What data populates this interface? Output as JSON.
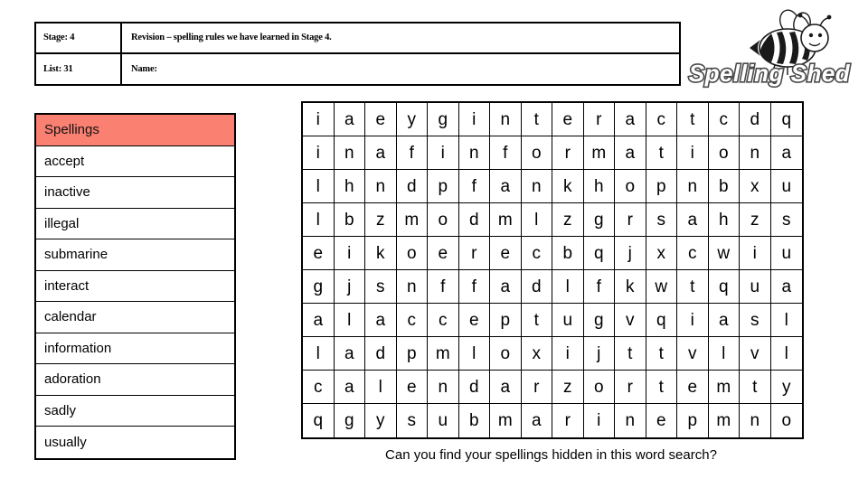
{
  "header": {
    "stage_label": "Stage: 4",
    "stage_value": "Revision – spelling rules we have learned in Stage 4.",
    "list_label": "List: 31",
    "name_label": "Name:"
  },
  "logo": {
    "text": "Spelling Shed",
    "icon": "bee-icon"
  },
  "spellings": {
    "header": "Spellings",
    "words": [
      "accept",
      "inactive",
      "illegal",
      "submarine",
      "interact",
      "calendar",
      "information",
      "adoration",
      "sadly",
      "usually"
    ]
  },
  "wordsearch": {
    "columns": 16,
    "rows": 10,
    "letters": [
      [
        "i",
        "a",
        "e",
        "y",
        "g",
        "i",
        "n",
        "t",
        "e",
        "r",
        "a",
        "c",
        "t",
        "c",
        "d",
        "q"
      ],
      [
        "i",
        "n",
        "a",
        "f",
        "i",
        "n",
        "f",
        "o",
        "r",
        "m",
        "a",
        "t",
        "i",
        "o",
        "n",
        "a"
      ],
      [
        "l",
        "h",
        "n",
        "d",
        "p",
        "f",
        "a",
        "n",
        "k",
        "h",
        "o",
        "p",
        "n",
        "b",
        "x",
        "u"
      ],
      [
        "l",
        "b",
        "z",
        "m",
        "o",
        "d",
        "m",
        "l",
        "z",
        "g",
        "r",
        "s",
        "a",
        "h",
        "z",
        "s"
      ],
      [
        "e",
        "i",
        "k",
        "o",
        "e",
        "r",
        "e",
        "c",
        "b",
        "q",
        "j",
        "x",
        "c",
        "w",
        "i",
        "u"
      ],
      [
        "g",
        "j",
        "s",
        "n",
        "f",
        "f",
        "a",
        "d",
        "l",
        "f",
        "k",
        "w",
        "t",
        "q",
        "u",
        "a"
      ],
      [
        "a",
        "l",
        "a",
        "c",
        "c",
        "e",
        "p",
        "t",
        "u",
        "g",
        "v",
        "q",
        "i",
        "a",
        "s",
        "l"
      ],
      [
        "l",
        "a",
        "d",
        "p",
        "m",
        "l",
        "o",
        "x",
        "i",
        "j",
        "t",
        "t",
        "v",
        "l",
        "v",
        "l"
      ],
      [
        "c",
        "a",
        "l",
        "e",
        "n",
        "d",
        "a",
        "r",
        "z",
        "o",
        "r",
        "t",
        "e",
        "m",
        "t",
        "y"
      ],
      [
        "q",
        "g",
        "y",
        "s",
        "u",
        "b",
        "m",
        "a",
        "r",
        "i",
        "n",
        "e",
        "p",
        "m",
        "n",
        "o"
      ]
    ]
  },
  "caption": "Can you find your spellings hidden in this word search?",
  "colors": {
    "header_fill": "#fa8072",
    "border": "#000000",
    "text": "#000000"
  }
}
